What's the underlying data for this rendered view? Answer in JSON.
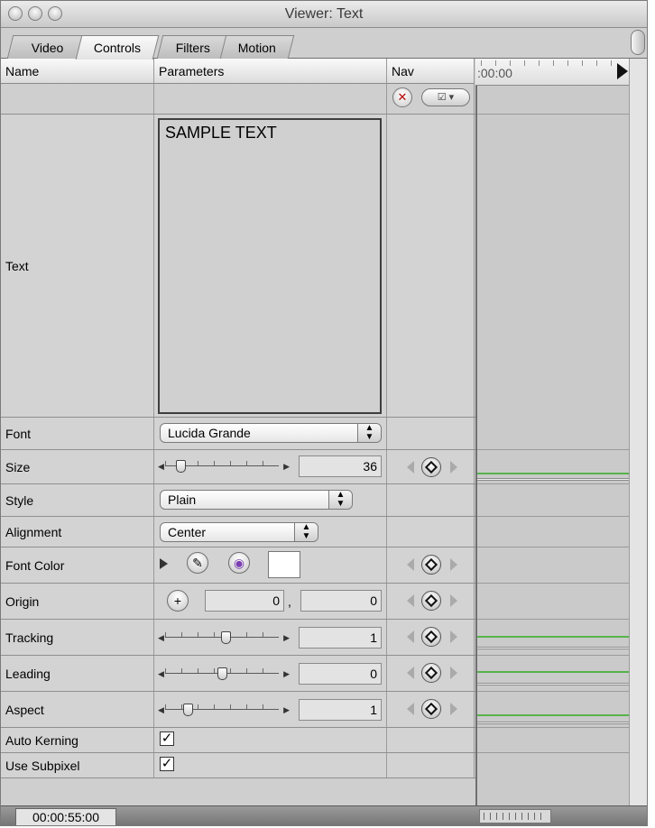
{
  "window": {
    "title": "Viewer: Text"
  },
  "tabs": [
    {
      "label": "Video",
      "active": false
    },
    {
      "label": "Controls",
      "active": true
    },
    {
      "label": "Filters",
      "active": false
    },
    {
      "label": "Motion",
      "active": false
    }
  ],
  "columns": {
    "name": "Name",
    "parameters": "Parameters",
    "nav": "Nav"
  },
  "timeline": {
    "start_time": ":00:00"
  },
  "rows": {
    "text": {
      "label": "Text",
      "value": "SAMPLE TEXT"
    },
    "font": {
      "label": "Font",
      "value": "Lucida Grande"
    },
    "size": {
      "label": "Size",
      "value": "36"
    },
    "style": {
      "label": "Style",
      "value": "Plain"
    },
    "alignment": {
      "label": "Alignment",
      "value": "Center"
    },
    "font_color": {
      "label": "Font Color",
      "color": "#ffffff"
    },
    "origin": {
      "label": "Origin",
      "x": "0",
      "y": "0",
      "separator": ","
    },
    "tracking": {
      "label": "Tracking",
      "value": "1"
    },
    "leading": {
      "label": "Leading",
      "value": "0"
    },
    "aspect": {
      "label": "Aspect",
      "value": "1"
    },
    "auto_kerning": {
      "label": "Auto Kerning",
      "checked": true
    },
    "use_subpixel": {
      "label": "Use Subpixel",
      "checked": true
    }
  },
  "footer": {
    "timecode": "00:00:55:00"
  },
  "colors": {
    "keyframe_line": "#57b34b",
    "reset_x": "#b40000"
  },
  "icons": {
    "reset": "x-circle-icon",
    "nav_menu": "checkbox-menu-icon",
    "eyedropper": "eyedropper-icon",
    "color_wheel": "color-wheel-icon",
    "crosshair": "crosshair-icon",
    "keyframe": "keyframe-diamond-icon"
  }
}
